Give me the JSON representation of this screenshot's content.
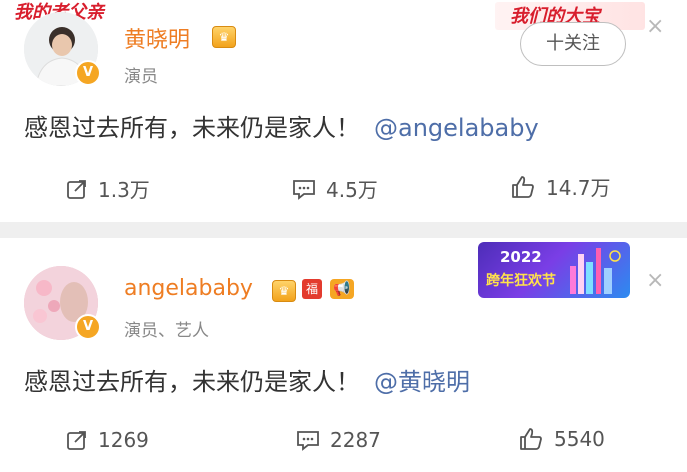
{
  "post1": {
    "username": "黄晓明",
    "verified_mark": "V",
    "role": "演员",
    "text": "感恩过去所有，未来仍是家人！",
    "mention": "@angelababy",
    "follow_button": "十关注",
    "decoration_label": "我的老父亲",
    "decoration_label_right": "我们的大宝",
    "stats": {
      "repost": "1.3万",
      "comment": "4.5万",
      "like": "14.7万"
    },
    "close": "×"
  },
  "post2": {
    "username": "angelababy",
    "verified_mark": "V",
    "role": "演员、艺人",
    "fu_badge": "福",
    "text": "感恩过去所有，未来仍是家人！",
    "mention": "@黄晓明",
    "banner_year": "2022",
    "banner_text": "跨年狂欢节",
    "stats": {
      "repost": "1269",
      "comment": "2287",
      "like": "5540"
    },
    "close": "×"
  },
  "colors": {
    "username": "#ee7d23",
    "mention": "#4e6ea8",
    "verified": "#f5a623",
    "separator": "#efefef"
  }
}
